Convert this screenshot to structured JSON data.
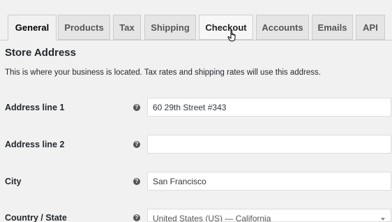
{
  "tabs": [
    {
      "label": "General",
      "active": true
    },
    {
      "label": "Products",
      "active": false
    },
    {
      "label": "Tax",
      "active": false
    },
    {
      "label": "Shipping",
      "active": false
    },
    {
      "label": "Checkout",
      "active": false
    },
    {
      "label": "Accounts",
      "active": false
    },
    {
      "label": "Emails",
      "active": false
    },
    {
      "label": "API",
      "active": false
    }
  ],
  "section": {
    "title": "Store Address",
    "description": "This is where your business is located. Tax rates and shipping rates will use this address."
  },
  "fields": [
    {
      "label": "Address line 1",
      "value": "60 29th Street #343",
      "help_icon": "help-icon"
    },
    {
      "label": "Address line 2",
      "value": "",
      "help_icon": "help-icon"
    },
    {
      "label": "City",
      "value": "San Francisco",
      "help_icon": "help-icon"
    },
    {
      "label": "Country / State",
      "value": "United States (US) — California",
      "help_icon": "help-icon"
    }
  ],
  "help_glyph": "?",
  "cursor": {
    "icon": "hand-pointer-icon"
  },
  "colors": {
    "background": "#f1f1f1",
    "tab_inactive": "#e5e5e5",
    "border": "#cccccc",
    "text": "#23282d"
  }
}
